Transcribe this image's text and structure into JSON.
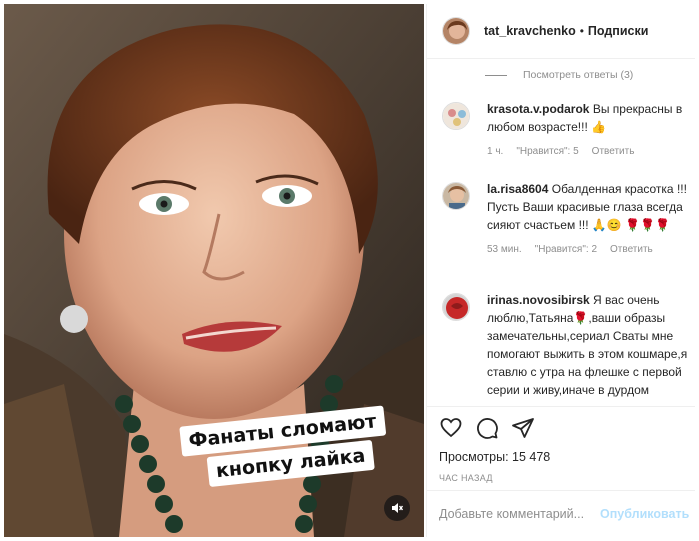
{
  "header": {
    "username": "tat_kravchenko",
    "separator": "•",
    "follow_label": "Подписки"
  },
  "comments_section": {
    "view_replies": "Посмотреть ответы (3)",
    "items": [
      {
        "username": "krasota.v.podarok",
        "text": "Вы прекрасны в любом возрасте!!! 👍",
        "time": "1 ч.",
        "likes": "\"Нравится\": 5",
        "reply": "Ответить"
      },
      {
        "username": "la.risa8604",
        "text": "Обалденная красотка !!! Пусть Ваши красивые глаза всегда сияют счастьем !!! 🙏😊 🌹🌹🌹",
        "time": "53 мин.",
        "likes": "\"Нравится\": 2",
        "reply": "Ответить"
      },
      {
        "username": "irinas.novosibirsk",
        "text": "Я вас очень люблю,Татьяна🌹,ваши образы замечательны,сериал Сваты мне помогают выжить в этом кошмаре,я ставлю с утра на флешке с первой серии и живу,иначе в дурдом попала"
      }
    ]
  },
  "actions": {
    "views_label": "Просмотры: 15 478",
    "time_ago": "ЧАС НАЗАД"
  },
  "add_comment": {
    "placeholder": "Добавьте комментарий...",
    "post_label": "Опубликовать"
  },
  "media": {
    "caption_line1": "Фанаты сломают",
    "caption_line2": "кнопку лайка"
  }
}
